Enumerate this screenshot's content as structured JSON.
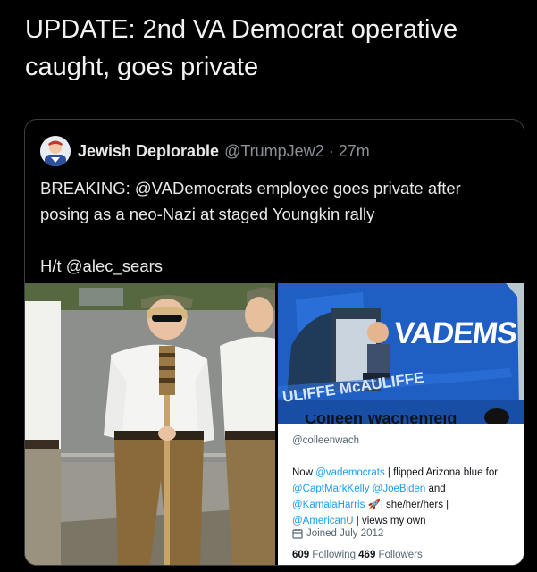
{
  "headline": "UPDATE: 2nd VA Democrat operative caught, goes private",
  "quoted_tweet": {
    "author_name": "Jewish Deplorable",
    "author_handle": "@TrumpJew2",
    "separator": "·",
    "time": "27m",
    "text_line1": "BREAKING: @VADemocrats employee goes private after posing as a neo-Nazi at staged Youngkin rally",
    "text_ht": "H/t @alec_sears"
  },
  "van": {
    "brand": "VADEMS",
    "lower_text": "ULIFFE McAULIFFE"
  },
  "profile": {
    "handle": "@colleenwach",
    "bio_prefix": "Now ",
    "bio_link1": "@vademocrats",
    "bio_mid1": " | flipped Arizona blue for",
    "bio_link2": "@CaptMarkKelly",
    "bio_space": " ",
    "bio_link3": "@JoeBiden",
    "bio_and": " and",
    "bio_link4": "@KamalaHarris",
    "bio_rocket": " 🚀| she/her/hers |",
    "bio_link5": "@AmericanU",
    "bio_end": " | views my own",
    "joined": "Joined July 2012",
    "following_count": "609",
    "following_label": " Following ",
    "followers_count": "469",
    "followers_label": " Followers"
  },
  "colors": {
    "background": "#000000",
    "link": "#1d9bf0",
    "van_blue": "#1f5fc4"
  }
}
